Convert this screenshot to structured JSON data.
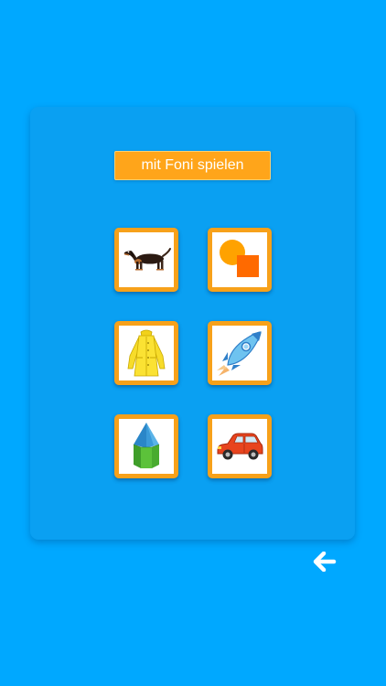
{
  "header": {
    "play_button_label": "mit Foni spielen"
  },
  "tiles": [
    {
      "icon": "dachshund-dog-icon"
    },
    {
      "icon": "circle-square-shapes-icon"
    },
    {
      "icon": "yellow-raincoat-icon"
    },
    {
      "icon": "rocket-icon"
    },
    {
      "icon": "hexagonal-prism-icon"
    },
    {
      "icon": "red-car-icon"
    }
  ],
  "navigation": {
    "back_icon": "arrow-left-icon"
  },
  "colors": {
    "background": "#00a8ff",
    "panel": "#0aa0f2",
    "accent": "#ffa51a",
    "tile_border": "#f7a11a"
  }
}
